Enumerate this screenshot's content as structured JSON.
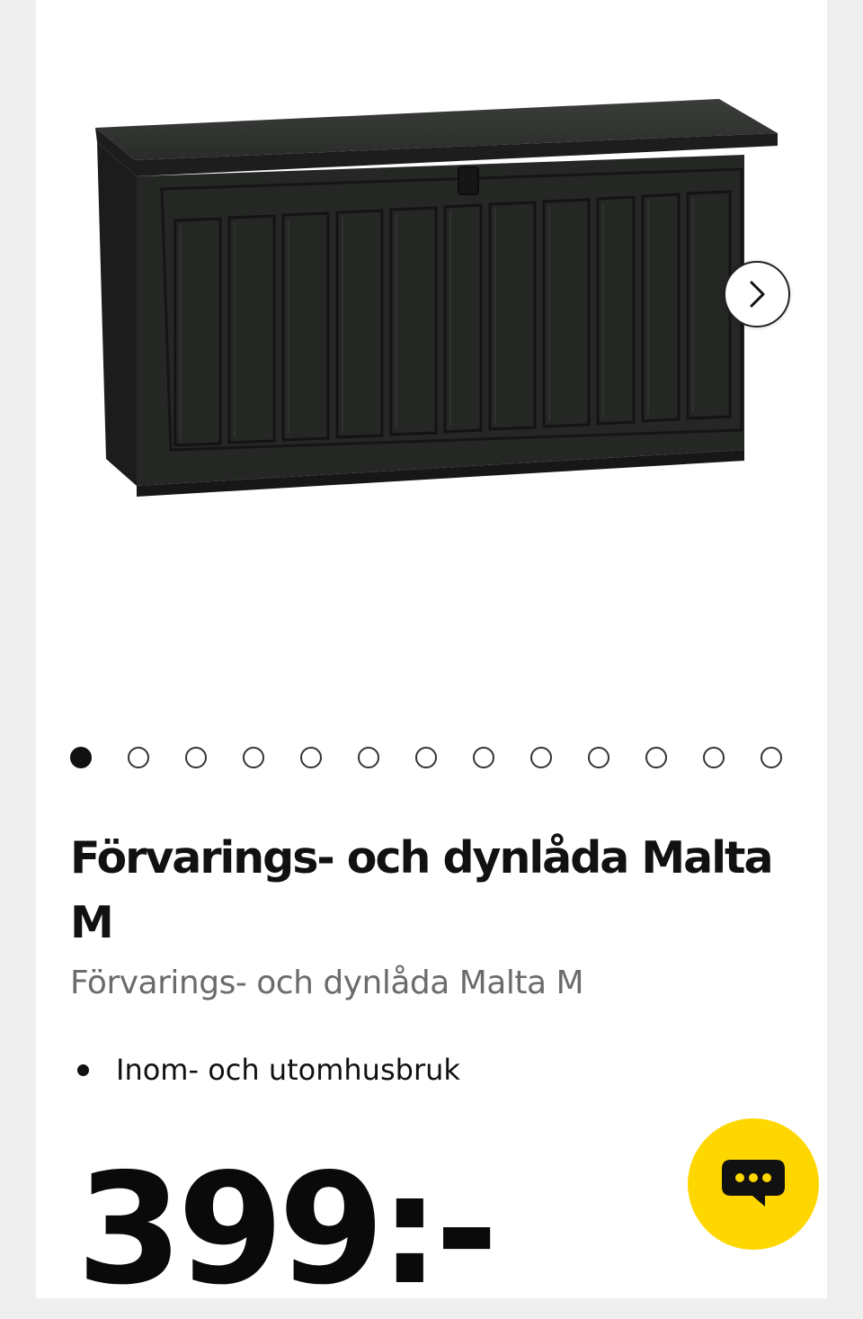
{
  "product": {
    "title": "Förvarings- och dynlåda Malta M",
    "subtitle": "Förvarings- och dynlåda Malta M",
    "features": [
      "Inom- och utomhusbruk"
    ],
    "price": "399:-"
  },
  "gallery": {
    "total_images": 13,
    "active_index": 0,
    "next_icon": "chevron-right-icon"
  },
  "chat": {
    "icon": "chat-bubble-icon",
    "color": "#ffd700"
  }
}
